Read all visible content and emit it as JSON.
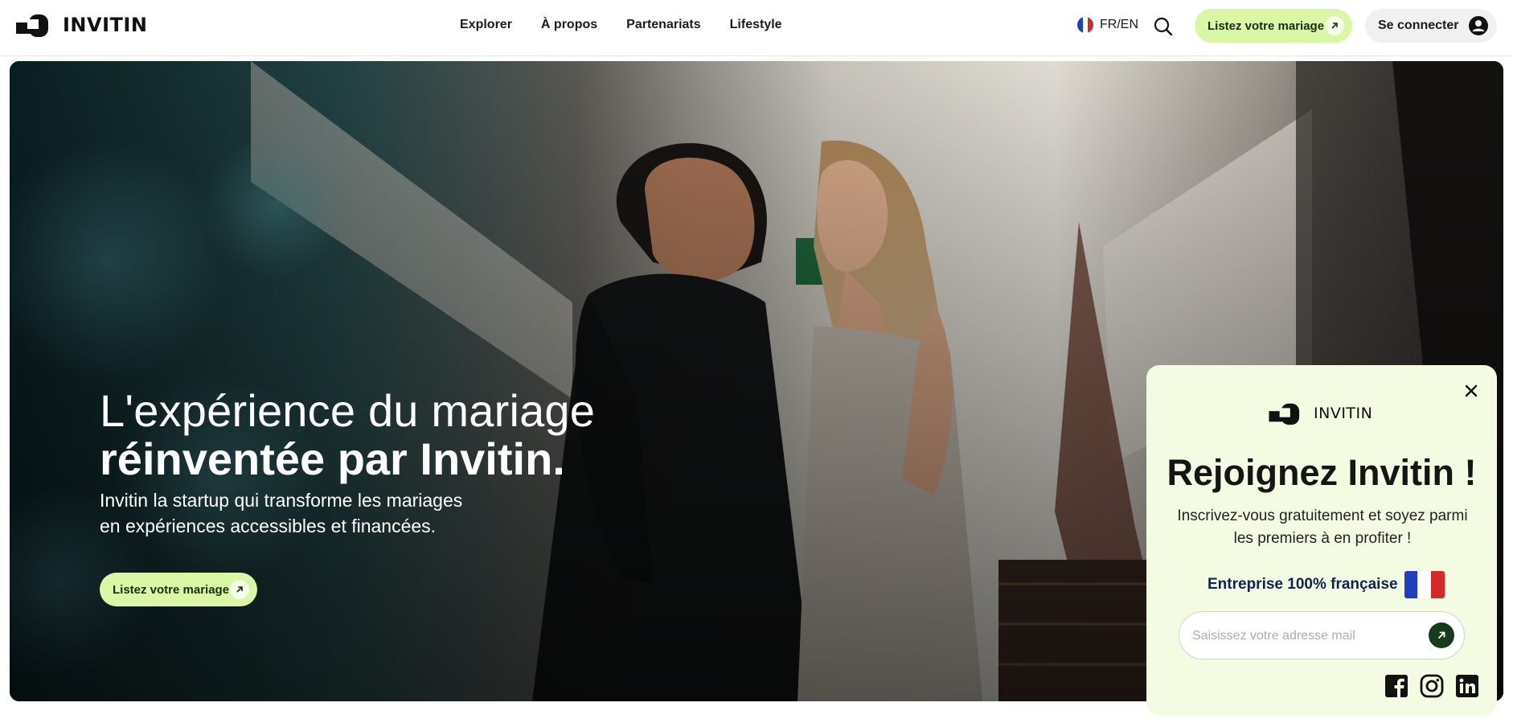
{
  "header": {
    "logo_text": "INVITIN",
    "nav": [
      "Explorer",
      "À propos",
      "Partenariats",
      "Lifestyle"
    ],
    "lang_label": "FR/EN",
    "cta_label": "Listez votre mariage",
    "login_label": "Se connecter"
  },
  "hero": {
    "title_line1": "L'expérience du mariage",
    "title_line2": "réinventée par Invitin.",
    "subtitle_line1": "Invitin la startup qui transforme les mariages",
    "subtitle_line2": "en expériences accessibles et financées.",
    "cta_label": "Listez votre mariage"
  },
  "popup": {
    "logo_text": "INVITIN",
    "title": "Rejoignez Invitin !",
    "subtitle_line1": "Inscrivez-vous gratuitement et soyez parmi",
    "subtitle_line2": "les premiers à en profiter !",
    "french_label": "Entreprise 100% française",
    "email_placeholder": "Saisissez votre adresse mail",
    "socials": [
      "facebook-icon",
      "instagram-icon",
      "linkedin-icon"
    ]
  },
  "colors": {
    "accent_green": "#d9f7a4",
    "popup_bg": "#f3fce3",
    "submit_dark": "#183a1c",
    "navy_text": "#0d2350",
    "flag_blue": "#1f3fbf",
    "flag_red": "#d62a2a"
  }
}
